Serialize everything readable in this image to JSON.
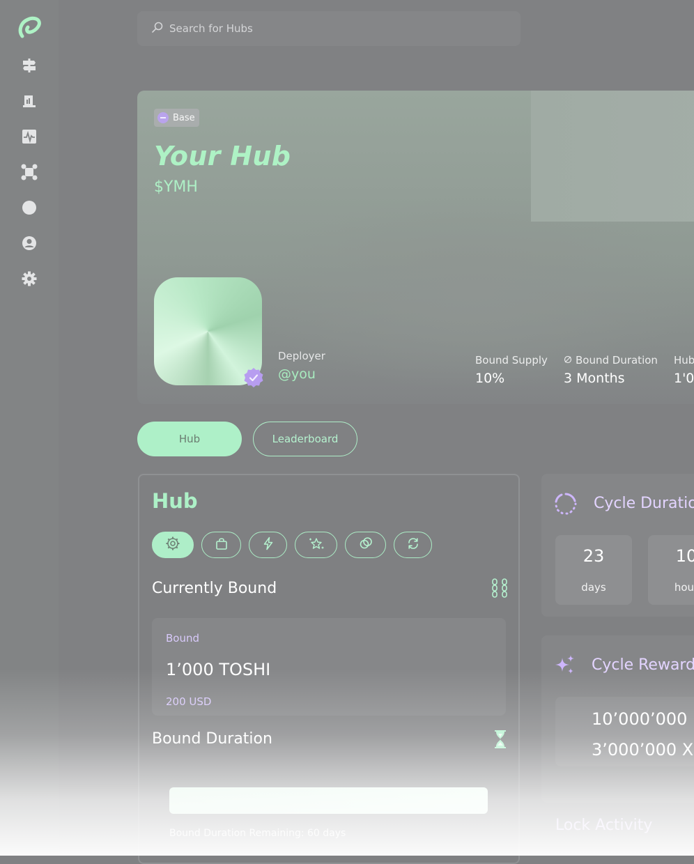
{
  "search": {
    "placeholder": "Search for Hubs"
  },
  "nav": {
    "icons": [
      "app-logo-icon",
      "signpost-icon",
      "receipt-icon",
      "activity-icon",
      "network-icon",
      "circle-icon",
      "profile-icon",
      "settings-icon"
    ]
  },
  "banner": {
    "chain": "Base",
    "title": "Your Hub",
    "ticker": "$YMH",
    "deployer_label": "Deployer",
    "deployer_value": "@you",
    "stats": [
      {
        "label": "Bound Supply",
        "value": "10%"
      },
      {
        "label": "Bound Duration",
        "value": "3 Months"
      },
      {
        "label": "Hub",
        "value": "1'0"
      }
    ]
  },
  "tabs": {
    "hub": "Hub",
    "leaderboard": "Leaderboard"
  },
  "hub_card": {
    "title": "Hub",
    "currently_bound": "Currently Bound",
    "bound_label": "Bound",
    "bound_amount": "1’000 TOSHI",
    "bound_usd": "200 USD",
    "bound_duration": "Bound Duration",
    "remaining": "Bound Duration Remaining: 60 days",
    "progress": 1.0
  },
  "cycle_duration": {
    "title": "Cycle Duratio",
    "days_value": "23",
    "days_unit": "days",
    "hours_value": "10",
    "hours_unit": "hour"
  },
  "cycle_rewards": {
    "title": "Cycle Reward",
    "line1": "10’000’000 (",
    "line2": "3’000’000 X"
  },
  "lock_activity": "Lock Activity",
  "colors": {
    "accent_green": "#AEF0C8",
    "accent_purple": "#D8C9FA",
    "background": "#808183"
  }
}
